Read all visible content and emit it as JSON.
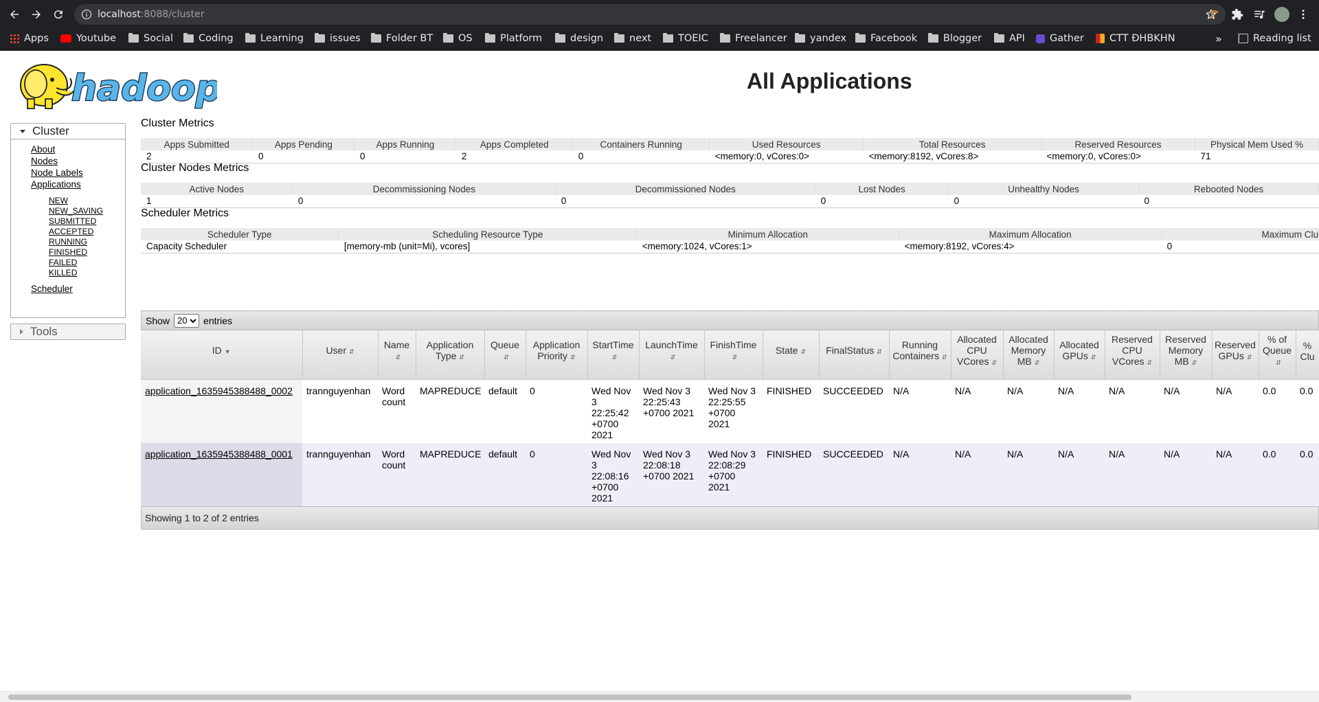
{
  "browser": {
    "url_host": "localhost",
    "url_rest": ":8088/cluster",
    "bookmarks": [
      {
        "label": "Apps",
        "icon": "apps-grid-icon"
      },
      {
        "label": "Youtube",
        "icon": "youtube-icon"
      },
      {
        "label": "Social",
        "icon": "folder-icon"
      },
      {
        "label": "Coding",
        "icon": "folder-icon"
      },
      {
        "label": "Learning",
        "icon": "folder-icon"
      },
      {
        "label": "issues",
        "icon": "folder-icon"
      },
      {
        "label": "Folder BT",
        "icon": "folder-icon"
      },
      {
        "label": "OS",
        "icon": "folder-icon"
      },
      {
        "label": "Platform",
        "icon": "folder-icon"
      },
      {
        "label": "design",
        "icon": "folder-icon"
      },
      {
        "label": "next",
        "icon": "folder-icon"
      },
      {
        "label": "TOEIC",
        "icon": "folder-icon"
      },
      {
        "label": "Freelancer",
        "icon": "folder-icon"
      },
      {
        "label": "yandex",
        "icon": "folder-icon"
      },
      {
        "label": "Facebook",
        "icon": "folder-icon"
      },
      {
        "label": "Blogger",
        "icon": "folder-icon"
      },
      {
        "label": "API",
        "icon": "folder-icon"
      },
      {
        "label": "Gather",
        "icon": "gather-icon"
      },
      {
        "label": "CTT ĐHBKHN",
        "icon": "ctt-icon"
      }
    ],
    "more": "»",
    "reading_list": "Reading list"
  },
  "page": {
    "title": "All Applications",
    "logo_text": "hadoop"
  },
  "sidebar": {
    "cluster": "Cluster",
    "links": [
      "About",
      "Nodes",
      "Node Labels",
      "Applications"
    ],
    "states": [
      "NEW",
      "NEW_SAVING",
      "SUBMITTED",
      "ACCEPTED",
      "RUNNING",
      "FINISHED",
      "FAILED",
      "KILLED"
    ],
    "scheduler": "Scheduler",
    "tools": "Tools"
  },
  "cluster_metrics": {
    "title": "Cluster Metrics",
    "headers": [
      "Apps Submitted",
      "Apps Pending",
      "Apps Running",
      "Apps Completed",
      "Containers Running",
      "Used Resources",
      "Total Resources",
      "Reserved Resources",
      "Physical Mem Used %"
    ],
    "values": [
      "2",
      "0",
      "0",
      "2",
      "0",
      "<memory:0, vCores:0>",
      "<memory:8192, vCores:8>",
      "<memory:0, vCores:0>",
      "71"
    ]
  },
  "node_metrics": {
    "title": "Cluster Nodes Metrics",
    "headers": [
      "Active Nodes",
      "Decommissioning Nodes",
      "Decommissioned Nodes",
      "Lost Nodes",
      "Unhealthy Nodes",
      "Rebooted Nodes"
    ],
    "values": [
      "1",
      "0",
      "0",
      "0",
      "0",
      "0"
    ]
  },
  "scheduler_metrics": {
    "title": "Scheduler Metrics",
    "headers": [
      "Scheduler Type",
      "Scheduling Resource Type",
      "Minimum Allocation",
      "Maximum Allocation",
      "Maximum Clu"
    ],
    "values": [
      "Capacity Scheduler",
      "[memory-mb (unit=Mi), vcores]",
      "<memory:1024, vCores:1>",
      "<memory:8192, vCores:4>",
      "0"
    ]
  },
  "table": {
    "show": "Show",
    "page_size": "20",
    "entries": "entries",
    "columns": [
      [
        "ID"
      ],
      [
        "User"
      ],
      [
        "Name"
      ],
      [
        "Application",
        "Type"
      ],
      [
        "Queue"
      ],
      [
        "Application",
        "Priority"
      ],
      [
        "StartTime"
      ],
      [
        "LaunchTime"
      ],
      [
        "FinishTime"
      ],
      [
        "State"
      ],
      [
        "FinalStatus"
      ],
      [
        "Running",
        "Containers"
      ],
      [
        "Allocated",
        "CPU",
        "VCores"
      ],
      [
        "Allocated",
        "Memory",
        "MB"
      ],
      [
        "Allocated",
        "GPUs"
      ],
      [
        "Reserved",
        "CPU",
        "VCores"
      ],
      [
        "Reserved",
        "Memory",
        "MB"
      ],
      [
        "Reserved",
        "GPUs"
      ],
      [
        "% of",
        "Queue"
      ],
      [
        "%",
        "Clu"
      ]
    ],
    "rows": [
      [
        "application_1635945388488_0002",
        "trannguyenhan",
        "Word count",
        "MAPREDUCE",
        "default",
        "0",
        "Wed Nov 3 22:25:42 +0700 2021",
        "Wed Nov 3 22:25:43 +0700 2021",
        "Wed Nov 3 22:25:55 +0700 2021",
        "FINISHED",
        "SUCCEEDED",
        "N/A",
        "N/A",
        "N/A",
        "N/A",
        "N/A",
        "N/A",
        "N/A",
        "0.0",
        "0.0"
      ],
      [
        "application_1635945388488_0001",
        "trannguyenhan",
        "Word count",
        "MAPREDUCE",
        "default",
        "0",
        "Wed Nov 3 22:08:16 +0700 2021",
        "Wed Nov 3 22:08:18 +0700 2021",
        "Wed Nov 3 22:08:29 +0700 2021",
        "FINISHED",
        "SUCCEEDED",
        "N/A",
        "N/A",
        "N/A",
        "N/A",
        "N/A",
        "N/A",
        "N/A",
        "0.0",
        "0.0"
      ]
    ],
    "footer": "Showing 1 to 2 of 2 entries"
  }
}
